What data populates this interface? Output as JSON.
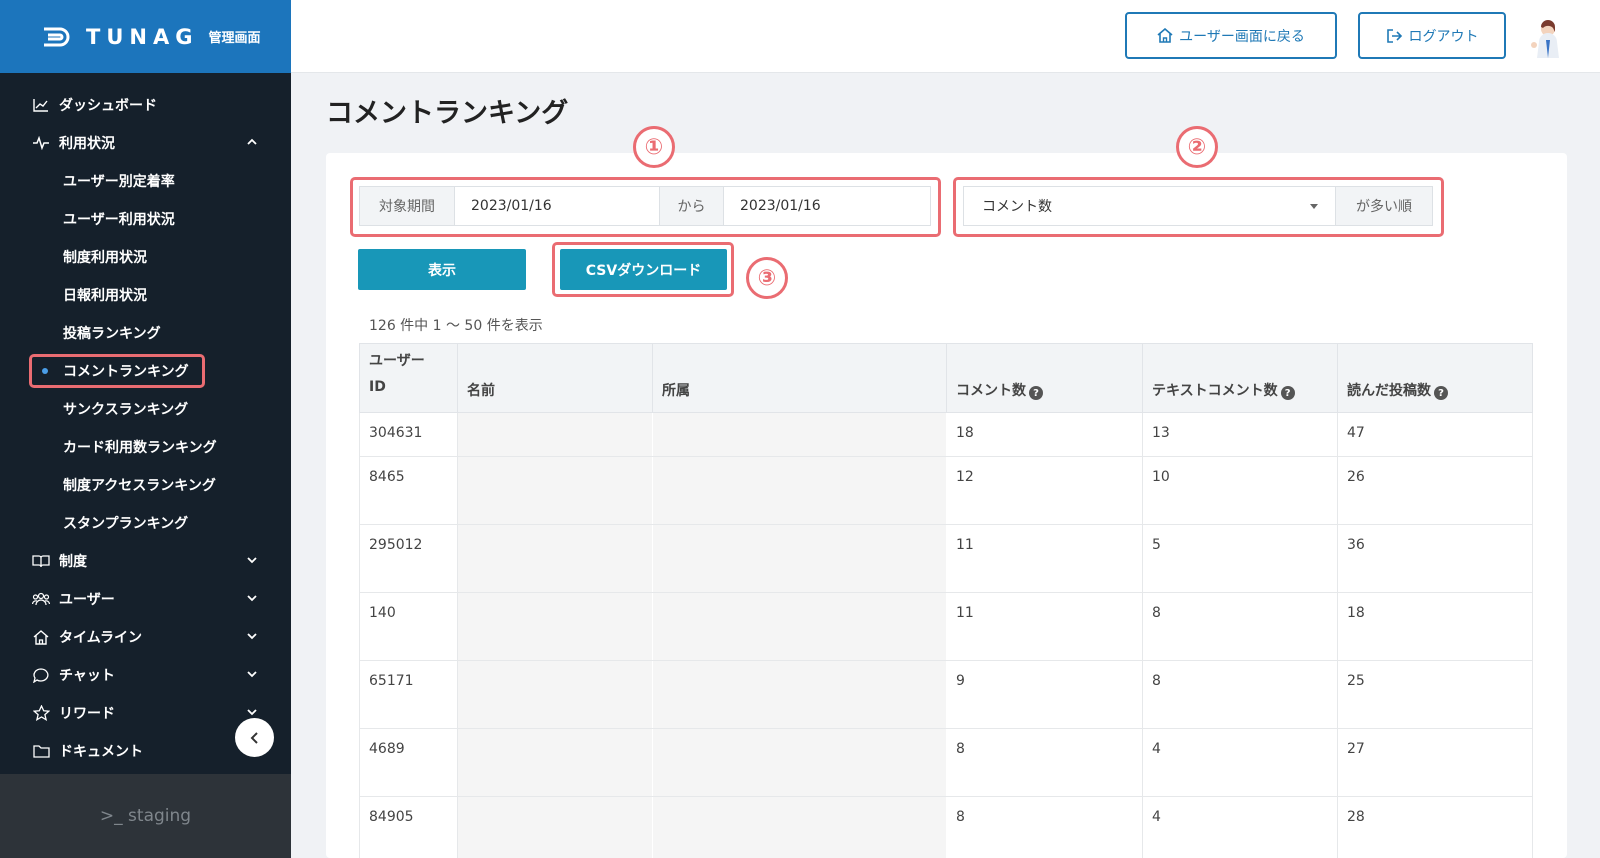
{
  "app": {
    "logo_text": "TUNAG",
    "logo_sub": "管理画面"
  },
  "sidebar": {
    "items": [
      {
        "label": "ダッシュボード",
        "icon": "chart-line-icon"
      },
      {
        "label": "利用状況",
        "icon": "pulse-icon",
        "expanded": true
      },
      {
        "label": "制度",
        "icon": "book-icon"
      },
      {
        "label": "ユーザー",
        "icon": "users-icon"
      },
      {
        "label": "タイムライン",
        "icon": "home-icon"
      },
      {
        "label": "チャット",
        "icon": "chat-bubble-icon"
      },
      {
        "label": "リワード",
        "icon": "star-icon"
      },
      {
        "label": "ドキュメント",
        "icon": "folder-icon"
      }
    ],
    "usage_sub_items": [
      "ユーザー別定着率",
      "ユーザー利用状況",
      "制度利用状況",
      "日報利用状況",
      "投稿ランキング",
      "コメントランキング",
      "サンクスランキング",
      "カード利用数ランキング",
      "制度アクセスランキング",
      "スタンプランキング"
    ],
    "active_item": "コメントランキング",
    "footer_env": ">_ staging"
  },
  "header": {
    "back_to_user_label": "ユーザー画面に戻る",
    "logout_label": "ログアウト"
  },
  "page": {
    "title": "コメントランキング"
  },
  "filters": {
    "period_label": "対象期間",
    "start_date": "2023/01/16",
    "from_label": "から",
    "end_date": "2023/01/16",
    "sort_select_value": "コメント数",
    "sort_suffix": "が多い順",
    "show_button": "表示",
    "csv_button": "CSVダウンロード"
  },
  "annotations": [
    "①",
    "②",
    "③"
  ],
  "result_count": "126 件中 1 〜 50 件を表示",
  "table": {
    "headers": [
      "ユーザー\nID",
      "名前",
      "所属",
      "コメント数",
      "テキストコメント数",
      "読んだ投稿数"
    ],
    "rows": [
      [
        "304631",
        "",
        "",
        "18",
        "13",
        "47"
      ],
      [
        "8465",
        "",
        "",
        "12",
        "10",
        "26"
      ],
      [
        "295012",
        "",
        "",
        "11",
        "5",
        "36"
      ],
      [
        "140",
        "",
        "",
        "11",
        "8",
        "18"
      ],
      [
        "65171",
        "",
        "",
        "9",
        "8",
        "25"
      ],
      [
        "4689",
        "",
        "",
        "8",
        "4",
        "27"
      ],
      [
        "84905",
        "",
        "",
        "8",
        "4",
        "28"
      ]
    ]
  },
  "colors": {
    "brand_blue": "#1c75bc",
    "sidebar_bg": "#15202b",
    "primary_button": "#1897b8",
    "annotation_red": "#ea6c72"
  }
}
